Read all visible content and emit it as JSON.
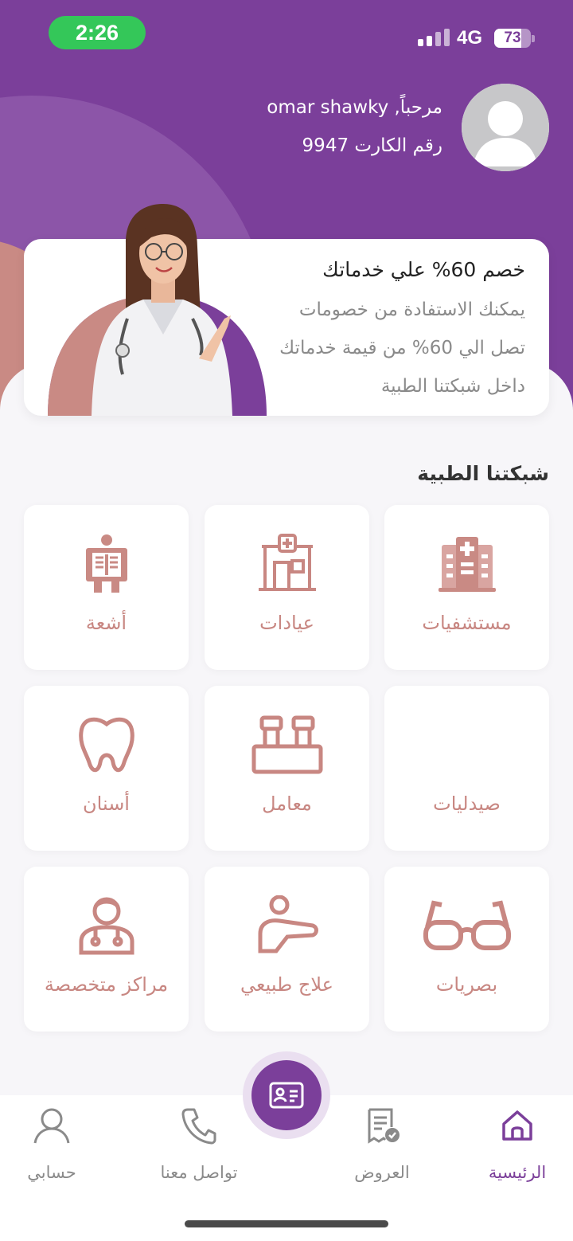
{
  "status_bar": {
    "time": "2:26",
    "network": "4G",
    "battery": "73",
    "battery_level": 0.73
  },
  "user": {
    "greeting": "مرحباً, omar shawky",
    "card_number": "رقم الكارت 9947"
  },
  "promo": {
    "title": "خصم 60% علي خدماتك",
    "lines": [
      "يمكنك الاستفادة من خصومات",
      "تصل الي 60% من قيمة خدماتك",
      "داخل شبكتنا الطبية"
    ]
  },
  "network_section": {
    "title": "شبكتنا الطبية",
    "tiles": [
      {
        "label": "مستشفيات",
        "icon": "hospital-icon"
      },
      {
        "label": "عيادات",
        "icon": "clinic-icon"
      },
      {
        "label": "أشعة",
        "icon": "xray-icon"
      },
      {
        "label": "صيدليات",
        "icon": ""
      },
      {
        "label": "معامل",
        "icon": "lab-tubes-icon"
      },
      {
        "label": "أسنان",
        "icon": "tooth-icon"
      },
      {
        "label": "بصريات",
        "icon": "glasses-icon"
      },
      {
        "label": "علاج طبيعي",
        "icon": "physiotherapy-icon"
      },
      {
        "label": "مراكز متخصصة",
        "icon": "doctor-icon"
      }
    ]
  },
  "bottom_nav": {
    "items": [
      {
        "label": "الرئيسية",
        "icon": "home-icon",
        "active": true
      },
      {
        "label": "العروض",
        "icon": "offers-icon",
        "active": false
      },
      {
        "label": "تواصل معنا",
        "icon": "phone-icon",
        "active": false
      },
      {
        "label": "حسابي",
        "icon": "account-icon",
        "active": false
      }
    ],
    "center_icon": "id-card-icon"
  },
  "colors": {
    "primary": "#7b3f9a",
    "accent": "#c88782",
    "status_green": "#34c759"
  }
}
